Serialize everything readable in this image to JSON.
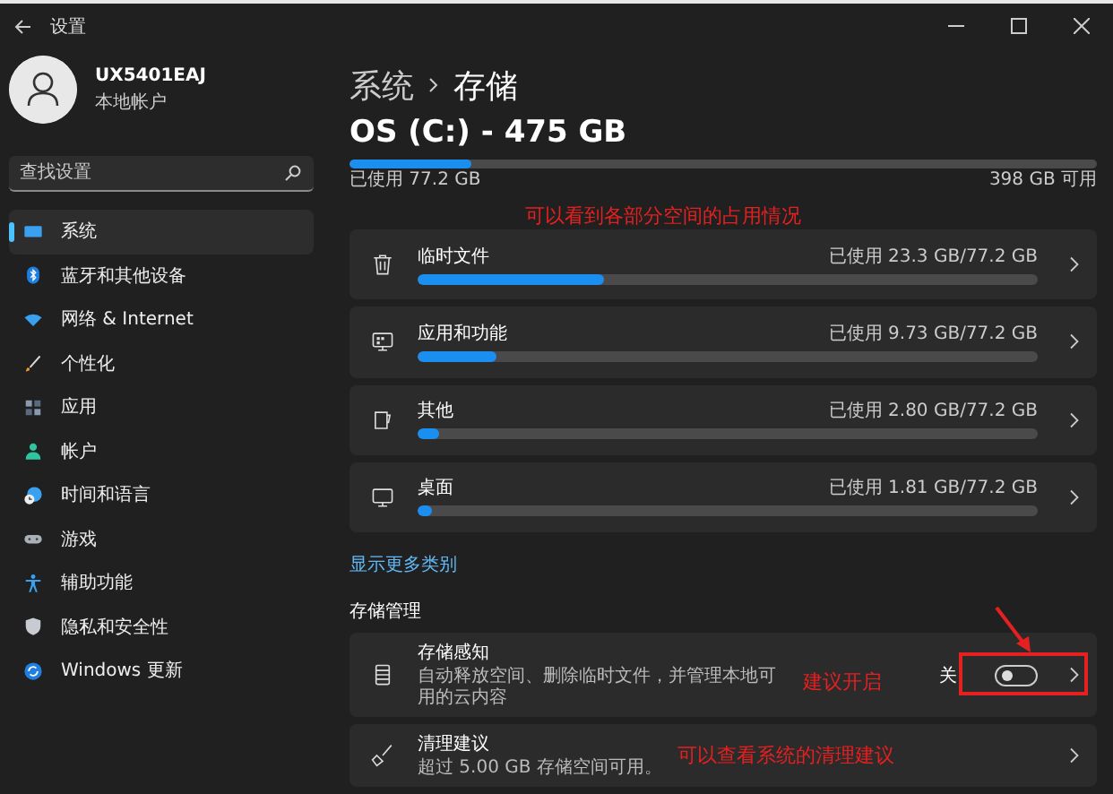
{
  "window": {
    "title": "设置"
  },
  "account": {
    "name": "UX5401EAJ",
    "type": "本地帐户"
  },
  "search": {
    "placeholder": "查找设置"
  },
  "nav": [
    {
      "kind": "system",
      "label": "系统",
      "selected": true
    },
    {
      "kind": "bluetooth",
      "label": "蓝牙和其他设备",
      "selected": false
    },
    {
      "kind": "network",
      "label": "网络 & Internet",
      "selected": false
    },
    {
      "kind": "personalize",
      "label": "个性化",
      "selected": false
    },
    {
      "kind": "apps",
      "label": "应用",
      "selected": false
    },
    {
      "kind": "accounts",
      "label": "帐户",
      "selected": false
    },
    {
      "kind": "time",
      "label": "时间和语言",
      "selected": false
    },
    {
      "kind": "gaming",
      "label": "游戏",
      "selected": false
    },
    {
      "kind": "accessibility",
      "label": "辅助功能",
      "selected": false
    },
    {
      "kind": "privacy",
      "label": "隐私和安全性",
      "selected": false
    },
    {
      "kind": "update",
      "label": "Windows 更新",
      "selected": false
    }
  ],
  "breadcrumb": {
    "parent": "系统",
    "current": "存储"
  },
  "drive": {
    "title": "OS (C:) - 475 GB",
    "level": 0.163,
    "used": "已使用 77.2 GB",
    "free": "398 GB 可用"
  },
  "categories": [
    {
      "kind": "trash",
      "label": "临时文件",
      "usage": "已使用 23.3 GB/77.2 GB",
      "level": 0.302
    },
    {
      "kind": "apps",
      "label": "应用和功能",
      "usage": "已使用 9.73 GB/77.2 GB",
      "level": 0.126
    },
    {
      "kind": "other",
      "label": "其他",
      "usage": "已使用 2.80 GB/77.2 GB",
      "level": 0.036
    },
    {
      "kind": "desktop",
      "label": "桌面",
      "usage": "已使用 1.81 GB/77.2 GB",
      "level": 0.023
    }
  ],
  "show_more": "显示更多类别",
  "management": {
    "heading": "存储管理",
    "items": [
      {
        "kind": "sense",
        "title": "存储感知",
        "description": "自动释放空间、删除临时文件，并管理本地可用的云内容",
        "toggle": {
          "label": "关",
          "on": false
        }
      },
      {
        "kind": "cleanup",
        "title": "清理建议",
        "description": "超过 5.00 GB 存储空间可用。"
      }
    ]
  },
  "annotations": [
    "可以看到各部分空间的占用情况",
    "建议开启",
    "可以查看系统的清理建议"
  ]
}
